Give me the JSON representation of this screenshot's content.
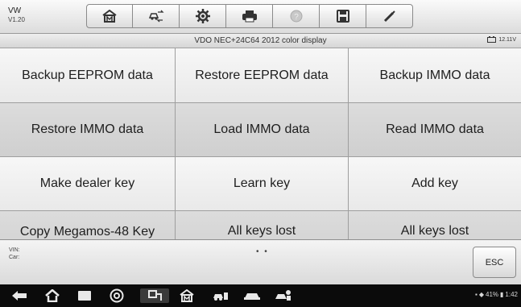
{
  "app": {
    "title": "VW",
    "version": "V1.20"
  },
  "toolbar": {
    "icons": [
      "home-icon",
      "vehicle-swap-icon",
      "settings-icon",
      "print-icon",
      "help-icon",
      "save-icon",
      "edit-icon"
    ]
  },
  "header": {
    "title": "VDO NEC+24C64 2012 color display",
    "battery": "12.11V"
  },
  "functions": [
    "Backup EEPROM data",
    "Restore EEPROM data",
    "Backup IMMO data",
    "Restore IMMO data",
    "Load IMMO data",
    "Read IMMO data",
    "Make dealer key",
    "Learn key",
    "Add key",
    "Copy Megamos-48 Key",
    "All keys lost",
    "All keys lost"
  ],
  "footer": {
    "vin_label": "VIN:",
    "car_label": "Car:",
    "page_dots": "• •",
    "esc_label": "ESC"
  },
  "statusbar": {
    "battery": "41%",
    "time": "1:42"
  },
  "navbar": {
    "icons": [
      "back-icon",
      "home-icon",
      "recent-apps-icon",
      "browser-icon",
      "vci-icon",
      "maxisys-home-icon",
      "vehicle-1-icon",
      "vehicle-2-icon",
      "vehicle-3-icon"
    ]
  }
}
